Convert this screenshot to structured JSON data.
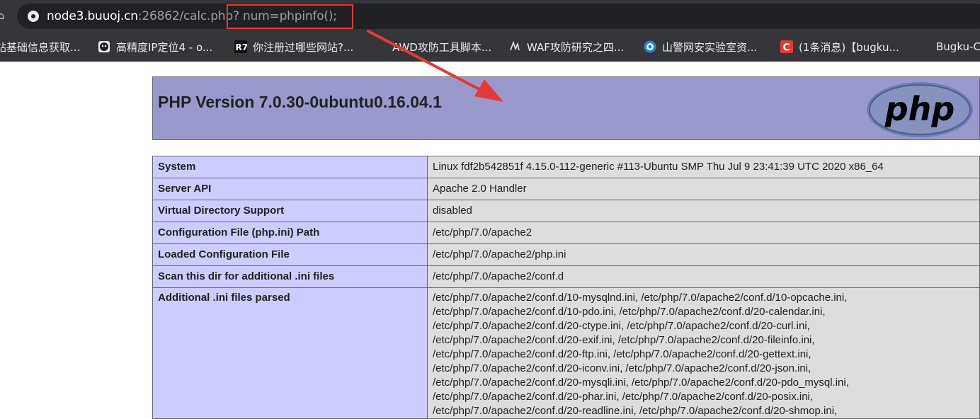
{
  "browser": {
    "url_host": "node3.buuoj.cn",
    "url_rest": ":26862/calc.php",
    "url_query": "? num=phpinfo();"
  },
  "bookmarks": [
    {
      "label": "站基础信息获取...",
      "icon": "page-icon"
    },
    {
      "label": "高精度IP定位4 - o...",
      "icon": "mask-icon"
    },
    {
      "label": "你注册过哪些网站?...",
      "icon": "r7-icon"
    },
    {
      "label": "AWD攻防工具脚本...",
      "icon": "page-icon"
    },
    {
      "label": "WAF攻防研究之四...",
      "icon": "scribble-icon"
    },
    {
      "label": "山警网安实验室资...",
      "icon": "globe-icon"
    },
    {
      "label": "(1条消息)【bugku...",
      "icon": "csdn-icon"
    },
    {
      "label": "Bugku-C",
      "icon": "page-icon"
    }
  ],
  "phpinfo": {
    "title": "PHP Version 7.0.30-0ubuntu0.16.04.1",
    "logo_text": "php",
    "rows": [
      {
        "key": "System",
        "value": "Linux fdf2b542851f 4.15.0-112-generic #113-Ubuntu SMP Thu Jul 9 23:41:39 UTC 2020 x86_64"
      },
      {
        "key": "Server API",
        "value": "Apache 2.0 Handler"
      },
      {
        "key": "Virtual Directory Support",
        "value": "disabled"
      },
      {
        "key": "Configuration File (php.ini) Path",
        "value": "/etc/php/7.0/apache2"
      },
      {
        "key": "Loaded Configuration File",
        "value": "/etc/php/7.0/apache2/php.ini"
      },
      {
        "key": "Scan this dir for additional .ini files",
        "value": "/etc/php/7.0/apache2/conf.d"
      }
    ],
    "additional_key": "Additional .ini files parsed",
    "additional_lines": [
      "/etc/php/7.0/apache2/conf.d/10-mysqlnd.ini, /etc/php/7.0/apache2/conf.d/10-opcache.ini,",
      "/etc/php/7.0/apache2/conf.d/10-pdo.ini, /etc/php/7.0/apache2/conf.d/20-calendar.ini,",
      "/etc/php/7.0/apache2/conf.d/20-ctype.ini, /etc/php/7.0/apache2/conf.d/20-curl.ini,",
      "/etc/php/7.0/apache2/conf.d/20-exif.ini, /etc/php/7.0/apache2/conf.d/20-fileinfo.ini,",
      "/etc/php/7.0/apache2/conf.d/20-ftp.ini, /etc/php/7.0/apache2/conf.d/20-gettext.ini,",
      "/etc/php/7.0/apache2/conf.d/20-iconv.ini, /etc/php/7.0/apache2/conf.d/20-json.ini,",
      "/etc/php/7.0/apache2/conf.d/20-mysqli.ini, /etc/php/7.0/apache2/conf.d/20-pdo_mysql.ini,",
      "/etc/php/7.0/apache2/conf.d/20-phar.ini, /etc/php/7.0/apache2/conf.d/20-posix.ini,",
      "/etc/php/7.0/apache2/conf.d/20-readline.ini, /etc/php/7.0/apache2/conf.d/20-shmop.ini,"
    ]
  },
  "colors": {
    "header_bg": "#9999cc",
    "key_bg": "#ccccff",
    "value_bg": "#dddddd",
    "annotation_red": "#e53935"
  }
}
